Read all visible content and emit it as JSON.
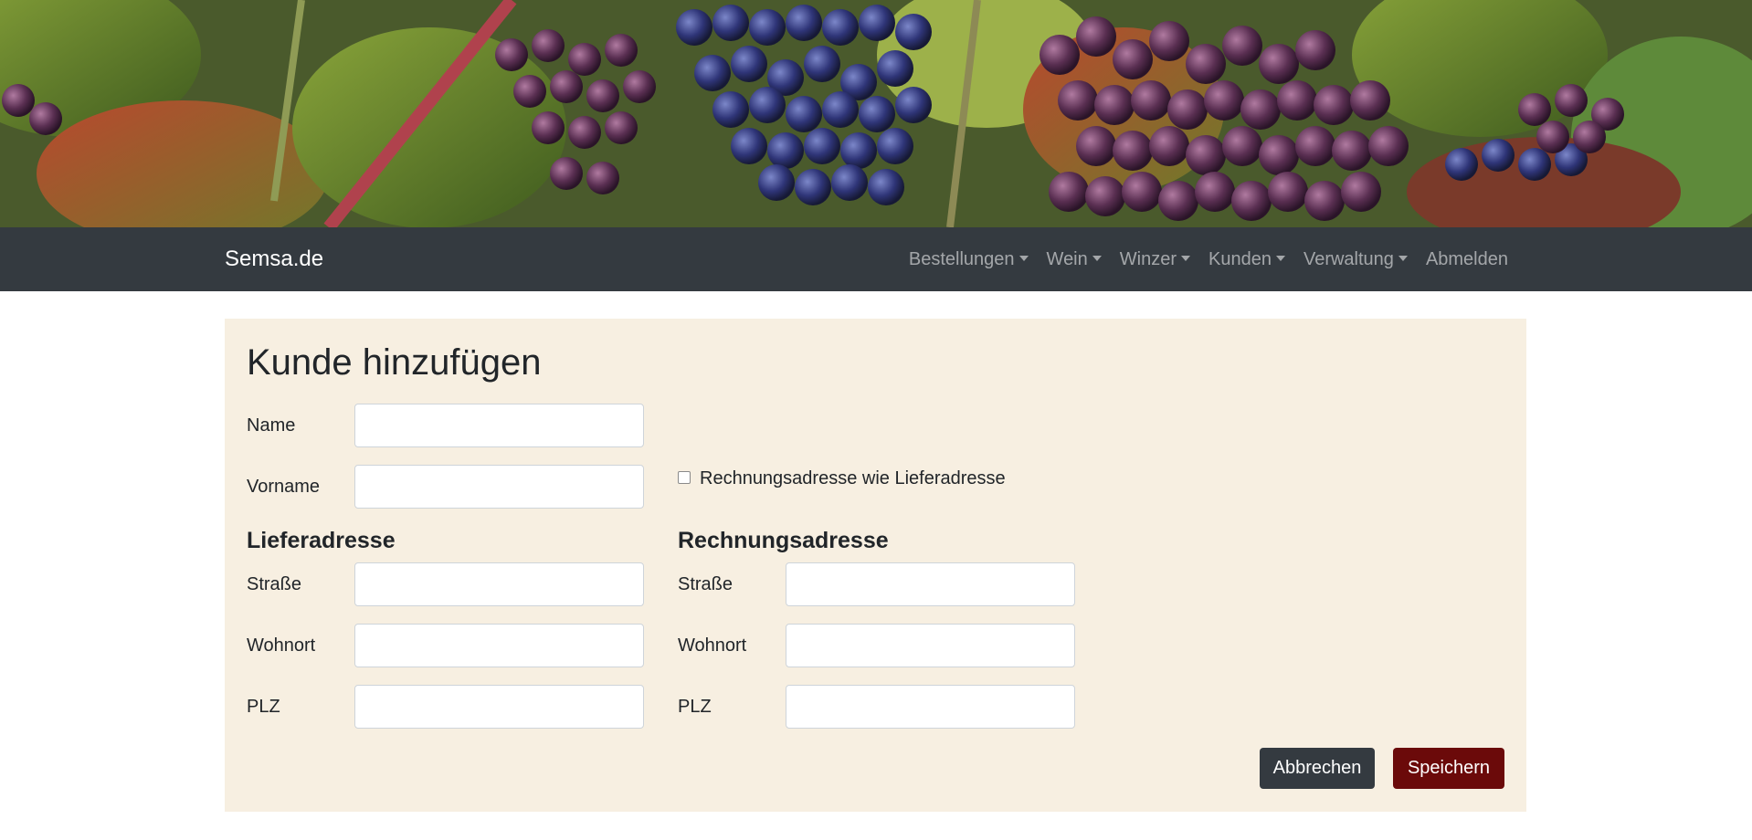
{
  "navbar": {
    "brand": "Semsa.de",
    "items": [
      {
        "label": "Bestellungen",
        "dropdown": true
      },
      {
        "label": "Wein",
        "dropdown": true
      },
      {
        "label": "Winzer",
        "dropdown": true
      },
      {
        "label": "Kunden",
        "dropdown": true
      },
      {
        "label": "Verwaltung",
        "dropdown": true
      },
      {
        "label": "Abmelden",
        "dropdown": false
      }
    ]
  },
  "form": {
    "title": "Kunde hinzufügen",
    "name_label": "Name",
    "name_value": "",
    "vorname_label": "Vorname",
    "vorname_value": "",
    "same_address_label": "Rechnungsadresse wie Lieferadresse",
    "same_address_checked": false,
    "delivery": {
      "heading": "Lieferadresse",
      "street_label": "Straße",
      "city_label": "Wohnort",
      "zip_label": "PLZ"
    },
    "billing": {
      "heading": "Rechnungsadresse",
      "street_label": "Straße",
      "city_label": "Wohnort",
      "zip_label": "PLZ"
    },
    "cancel_label": "Abbrechen",
    "save_label": "Speichern"
  },
  "colors": {
    "navbar_bg": "#343a40",
    "card_bg": "#f7efe1",
    "save_button": "#6b0a0a",
    "cancel_button": "#343a40"
  }
}
